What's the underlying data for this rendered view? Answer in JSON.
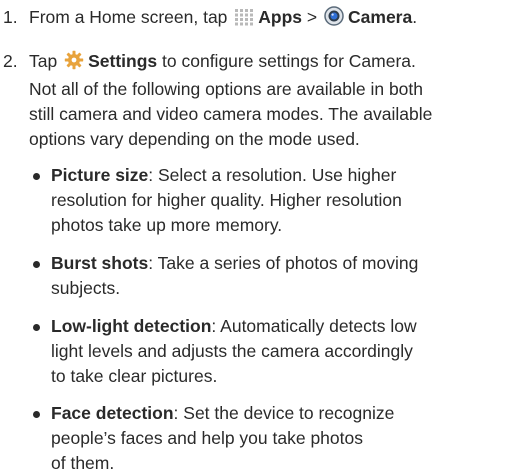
{
  "steps": [
    {
      "number": "1.",
      "prefix": "From a Home screen, tap",
      "apps_label": "Apps",
      "separator": ">",
      "camera_label": "Camera",
      "suffix": "."
    },
    {
      "number": "2.",
      "prefix": "Tap",
      "settings_label": "Settings",
      "lines": [
        "to configure settings for Camera.",
        "Not all of the following options are available in both",
        "still camera and video camera modes. The available",
        "options vary depending on the mode used."
      ]
    }
  ],
  "bullets": [
    {
      "term": "Picture size",
      "lines": [
        ": Select a resolution. Use higher",
        "resolution for higher quality. Higher resolution",
        "photos take up more memory."
      ]
    },
    {
      "term": "Burst shots",
      "lines": [
        ": Take a series of photos of moving",
        "subjects."
      ]
    },
    {
      "term": "Low-light detection",
      "lines": [
        ": Automatically detects low",
        "light levels and adjusts the camera accordingly",
        "to take clear pictures."
      ]
    },
    {
      "term": "Face detection",
      "lines": [
        ": Set the device to recognize",
        "people’s faces and help you take photos",
        "of them."
      ]
    }
  ],
  "icons": {
    "apps": "apps-grid-icon",
    "camera": "camera-app-icon",
    "settings": "settings-gear-icon"
  },
  "colors": {
    "text": "#2a2a2a",
    "settings_icon": "#e8a33c",
    "camera_ring": "#5b6b7a",
    "camera_lens": "#2f6fd6",
    "apps_dots": "#b9b9b9"
  }
}
